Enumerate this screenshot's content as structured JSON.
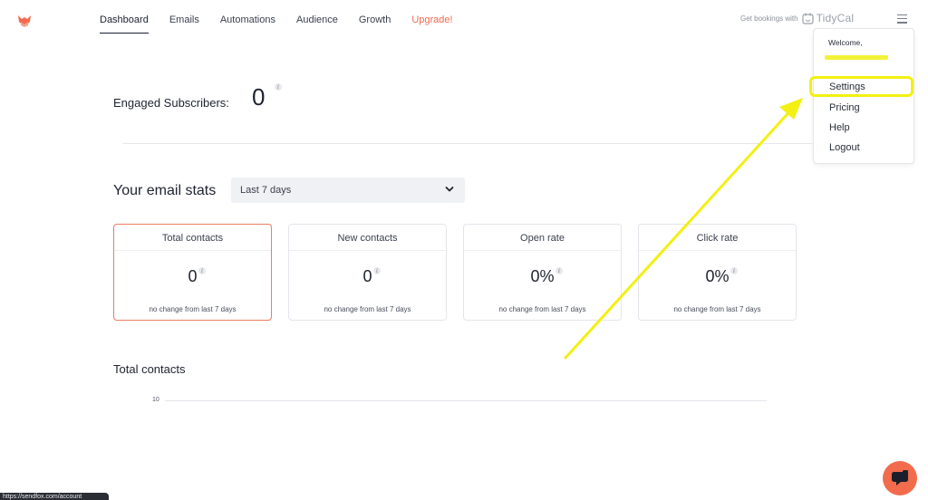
{
  "nav": {
    "items": [
      {
        "label": "Dashboard",
        "active": true
      },
      {
        "label": "Emails",
        "active": false
      },
      {
        "label": "Automations",
        "active": false
      },
      {
        "label": "Audience",
        "active": false
      },
      {
        "label": "Growth",
        "active": false
      },
      {
        "label": "Upgrade!",
        "active": false
      }
    ],
    "logo_icon": "fox-logo-icon",
    "menu_icon": "hamburger-icon"
  },
  "tidycal": {
    "prompt": "Get bookings with",
    "brand": "TidyCal",
    "icon": "calendar-icon"
  },
  "user_menu": {
    "welcome": "Welcome,",
    "items": [
      "Settings",
      "Pricing",
      "Help",
      "Logout"
    ],
    "highlighted": "Settings"
  },
  "engaged": {
    "label": "Engaged Subscribers:",
    "value": "0",
    "info_icon": "info-icon"
  },
  "stats": {
    "title": "Your email stats",
    "period": "Last 7 days",
    "cards": [
      {
        "title": "Total contacts",
        "value": "0",
        "note": "no change from last 7 days",
        "selected": true
      },
      {
        "title": "New contacts",
        "value": "0",
        "note": "no change from last 7 days",
        "selected": false
      },
      {
        "title": "Open rate",
        "value": "0%",
        "note": "no change from last 7 days",
        "selected": false
      },
      {
        "title": "Click rate",
        "value": "0%",
        "note": "no change from last 7 days",
        "selected": false
      }
    ]
  },
  "chart": {
    "title": "Total contacts",
    "y_tick": "10"
  },
  "statusbar": {
    "url": "https://sendfox.com/account"
  },
  "colors": {
    "accent": "#f26b4d",
    "highlight": "#f3f013",
    "selected_border": "#ef7a62"
  }
}
